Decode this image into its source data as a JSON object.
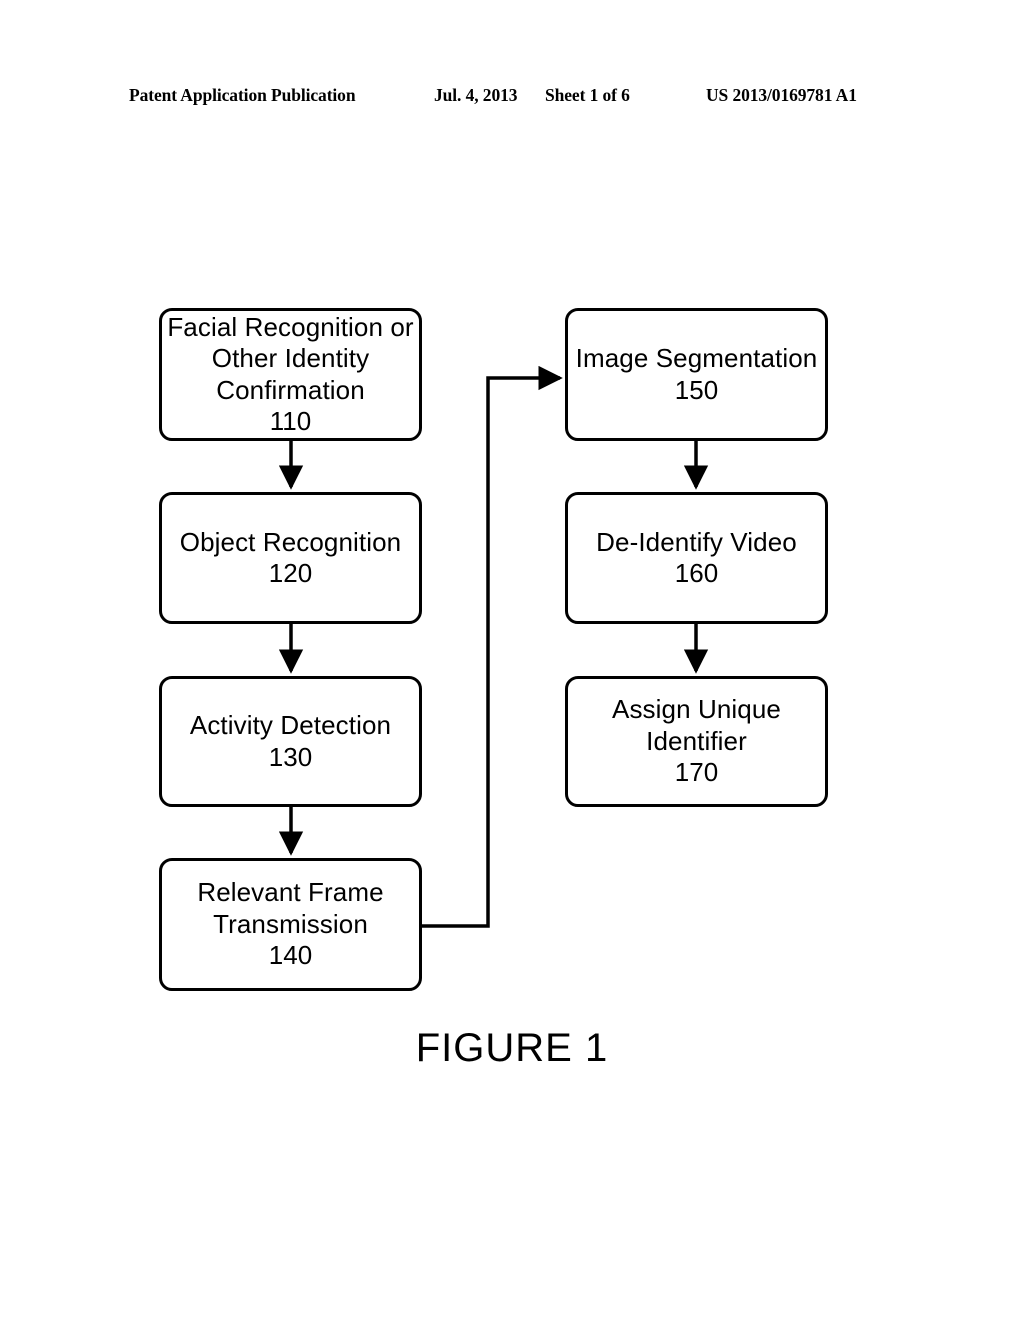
{
  "header": {
    "publication": "Patent Application Publication",
    "date": "Jul. 4, 2013",
    "sheet": "Sheet 1 of 6",
    "patent_number": "US 2013/0169781 A1"
  },
  "figure": {
    "caption": "FIGURE 1",
    "background_color": "#ffffff",
    "line_color": "#000000"
  },
  "diagram_data": {
    "type": "flowchart",
    "title": "FIGURE 1",
    "nodes": [
      {
        "id": "110",
        "ref_numeral": "110",
        "lines": [
          "Facial Recognition or",
          "Other Identity",
          "Confirmation"
        ],
        "column": "left",
        "order": 1
      },
      {
        "id": "120",
        "ref_numeral": "120",
        "lines": [
          "Object Recognition"
        ],
        "column": "left",
        "order": 2
      },
      {
        "id": "130",
        "ref_numeral": "130",
        "lines": [
          "Activity Detection"
        ],
        "column": "left",
        "order": 3
      },
      {
        "id": "140",
        "ref_numeral": "140",
        "lines": [
          "Relevant Frame",
          "Transmission"
        ],
        "column": "left",
        "order": 4
      },
      {
        "id": "150",
        "ref_numeral": "150",
        "lines": [
          "Image Segmentation"
        ],
        "column": "right",
        "order": 5
      },
      {
        "id": "160",
        "ref_numeral": "160",
        "lines": [
          "De-Identify Video"
        ],
        "column": "right",
        "order": 6
      },
      {
        "id": "170",
        "ref_numeral": "170",
        "lines": [
          "Assign Unique",
          "Identifier"
        ],
        "column": "right",
        "order": 7
      }
    ],
    "edges": [
      {
        "from": "110",
        "to": "120",
        "style": "straight-down"
      },
      {
        "from": "120",
        "to": "130",
        "style": "straight-down"
      },
      {
        "from": "130",
        "to": "140",
        "style": "straight-down"
      },
      {
        "from": "140",
        "to": "150",
        "style": "elbow-right-up"
      },
      {
        "from": "150",
        "to": "160",
        "style": "straight-down"
      },
      {
        "from": "160",
        "to": "170",
        "style": "straight-down"
      }
    ]
  },
  "boxes": {
    "b110": {
      "l1": "Facial Recognition or",
      "l2": "Other Identity",
      "l3": "Confirmation",
      "num": "110"
    },
    "b120": {
      "l1": "Object Recognition",
      "num": "120"
    },
    "b130": {
      "l1": "Activity Detection",
      "num": "130"
    },
    "b140": {
      "l1": "Relevant Frame",
      "l2": "Transmission",
      "num": "140"
    },
    "b150": {
      "l1": "Image Segmentation",
      "num": "150"
    },
    "b160": {
      "l1": "De-Identify Video",
      "num": "160"
    },
    "b170": {
      "l1": "Assign Unique",
      "l2": "Identifier",
      "num": "170"
    }
  }
}
